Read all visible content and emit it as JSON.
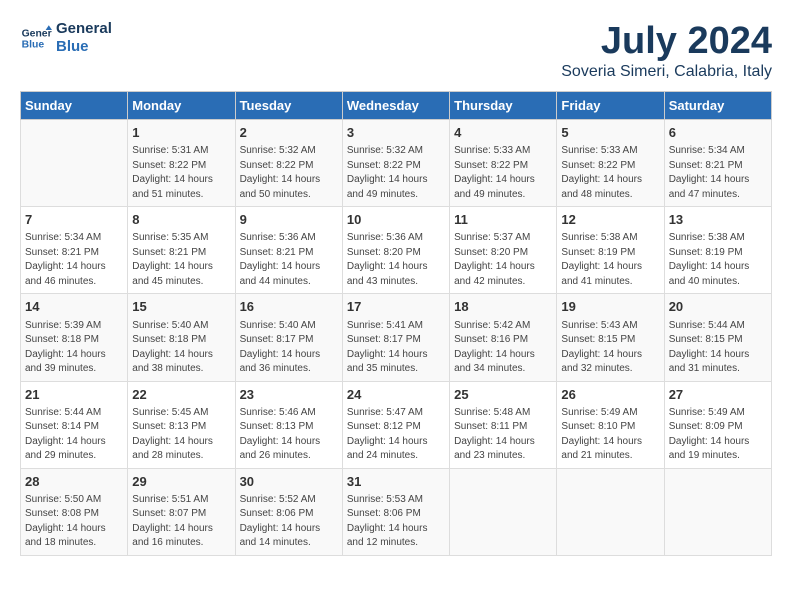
{
  "logo": {
    "line1": "General",
    "line2": "Blue"
  },
  "title": "July 2024",
  "subtitle": "Soveria Simeri, Calabria, Italy",
  "headers": [
    "Sunday",
    "Monday",
    "Tuesday",
    "Wednesday",
    "Thursday",
    "Friday",
    "Saturday"
  ],
  "weeks": [
    [
      {
        "day": "",
        "info": ""
      },
      {
        "day": "1",
        "info": "Sunrise: 5:31 AM\nSunset: 8:22 PM\nDaylight: 14 hours\nand 51 minutes."
      },
      {
        "day": "2",
        "info": "Sunrise: 5:32 AM\nSunset: 8:22 PM\nDaylight: 14 hours\nand 50 minutes."
      },
      {
        "day": "3",
        "info": "Sunrise: 5:32 AM\nSunset: 8:22 PM\nDaylight: 14 hours\nand 49 minutes."
      },
      {
        "day": "4",
        "info": "Sunrise: 5:33 AM\nSunset: 8:22 PM\nDaylight: 14 hours\nand 49 minutes."
      },
      {
        "day": "5",
        "info": "Sunrise: 5:33 AM\nSunset: 8:22 PM\nDaylight: 14 hours\nand 48 minutes."
      },
      {
        "day": "6",
        "info": "Sunrise: 5:34 AM\nSunset: 8:21 PM\nDaylight: 14 hours\nand 47 minutes."
      }
    ],
    [
      {
        "day": "7",
        "info": "Sunrise: 5:34 AM\nSunset: 8:21 PM\nDaylight: 14 hours\nand 46 minutes."
      },
      {
        "day": "8",
        "info": "Sunrise: 5:35 AM\nSunset: 8:21 PM\nDaylight: 14 hours\nand 45 minutes."
      },
      {
        "day": "9",
        "info": "Sunrise: 5:36 AM\nSunset: 8:21 PM\nDaylight: 14 hours\nand 44 minutes."
      },
      {
        "day": "10",
        "info": "Sunrise: 5:36 AM\nSunset: 8:20 PM\nDaylight: 14 hours\nand 43 minutes."
      },
      {
        "day": "11",
        "info": "Sunrise: 5:37 AM\nSunset: 8:20 PM\nDaylight: 14 hours\nand 42 minutes."
      },
      {
        "day": "12",
        "info": "Sunrise: 5:38 AM\nSunset: 8:19 PM\nDaylight: 14 hours\nand 41 minutes."
      },
      {
        "day": "13",
        "info": "Sunrise: 5:38 AM\nSunset: 8:19 PM\nDaylight: 14 hours\nand 40 minutes."
      }
    ],
    [
      {
        "day": "14",
        "info": "Sunrise: 5:39 AM\nSunset: 8:18 PM\nDaylight: 14 hours\nand 39 minutes."
      },
      {
        "day": "15",
        "info": "Sunrise: 5:40 AM\nSunset: 8:18 PM\nDaylight: 14 hours\nand 38 minutes."
      },
      {
        "day": "16",
        "info": "Sunrise: 5:40 AM\nSunset: 8:17 PM\nDaylight: 14 hours\nand 36 minutes."
      },
      {
        "day": "17",
        "info": "Sunrise: 5:41 AM\nSunset: 8:17 PM\nDaylight: 14 hours\nand 35 minutes."
      },
      {
        "day": "18",
        "info": "Sunrise: 5:42 AM\nSunset: 8:16 PM\nDaylight: 14 hours\nand 34 minutes."
      },
      {
        "day": "19",
        "info": "Sunrise: 5:43 AM\nSunset: 8:15 PM\nDaylight: 14 hours\nand 32 minutes."
      },
      {
        "day": "20",
        "info": "Sunrise: 5:44 AM\nSunset: 8:15 PM\nDaylight: 14 hours\nand 31 minutes."
      }
    ],
    [
      {
        "day": "21",
        "info": "Sunrise: 5:44 AM\nSunset: 8:14 PM\nDaylight: 14 hours\nand 29 minutes."
      },
      {
        "day": "22",
        "info": "Sunrise: 5:45 AM\nSunset: 8:13 PM\nDaylight: 14 hours\nand 28 minutes."
      },
      {
        "day": "23",
        "info": "Sunrise: 5:46 AM\nSunset: 8:13 PM\nDaylight: 14 hours\nand 26 minutes."
      },
      {
        "day": "24",
        "info": "Sunrise: 5:47 AM\nSunset: 8:12 PM\nDaylight: 14 hours\nand 24 minutes."
      },
      {
        "day": "25",
        "info": "Sunrise: 5:48 AM\nSunset: 8:11 PM\nDaylight: 14 hours\nand 23 minutes."
      },
      {
        "day": "26",
        "info": "Sunrise: 5:49 AM\nSunset: 8:10 PM\nDaylight: 14 hours\nand 21 minutes."
      },
      {
        "day": "27",
        "info": "Sunrise: 5:49 AM\nSunset: 8:09 PM\nDaylight: 14 hours\nand 19 minutes."
      }
    ],
    [
      {
        "day": "28",
        "info": "Sunrise: 5:50 AM\nSunset: 8:08 PM\nDaylight: 14 hours\nand 18 minutes."
      },
      {
        "day": "29",
        "info": "Sunrise: 5:51 AM\nSunset: 8:07 PM\nDaylight: 14 hours\nand 16 minutes."
      },
      {
        "day": "30",
        "info": "Sunrise: 5:52 AM\nSunset: 8:06 PM\nDaylight: 14 hours\nand 14 minutes."
      },
      {
        "day": "31",
        "info": "Sunrise: 5:53 AM\nSunset: 8:06 PM\nDaylight: 14 hours\nand 12 minutes."
      },
      {
        "day": "",
        "info": ""
      },
      {
        "day": "",
        "info": ""
      },
      {
        "day": "",
        "info": ""
      }
    ]
  ]
}
